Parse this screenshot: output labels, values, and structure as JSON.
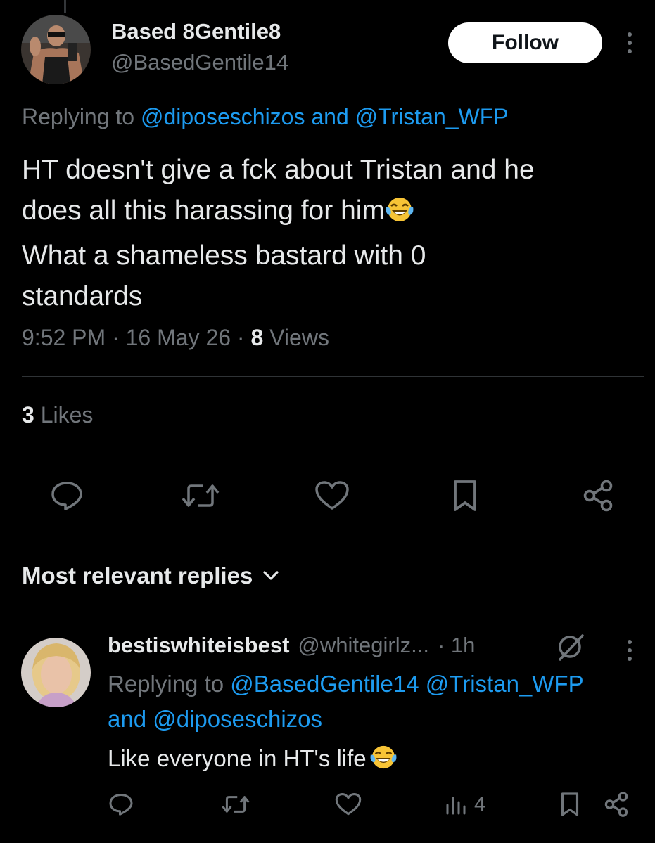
{
  "tweet": {
    "display_name": "Based 8Gentile8",
    "handle": "@BasedGentile14",
    "follow_label": "Follow",
    "replying_prefix": "Replying to",
    "replying_mention_1": "@diposeschizos",
    "replying_and": "and",
    "replying_mention_2": "@Tristan_WFP",
    "text_line_1": "HT doesn't give a fck about Tristan and he",
    "text_line_2": "does all this harassing for him",
    "text_line_3": "What a shameless bastard with 0",
    "text_line_4": "standards",
    "time": "9:52 PM",
    "dot": "·",
    "date": "16 May 26",
    "views_count": "8",
    "views_label": "Views",
    "likes_count": "3",
    "likes_label": "Likes"
  },
  "replies_header": {
    "label": "Most relevant replies"
  },
  "reply": {
    "display_name": "bestiswhiteisbest",
    "handle": "@whitegirlz...",
    "time": "· 1h",
    "replying_prefix": "Replying to",
    "mention_1": "@BasedGentile14",
    "mention_2": "@Tristan_WFP",
    "and": "and",
    "mention_3": "@diposeschizos",
    "text": "Like everyone in HT's life",
    "views_count": "4"
  },
  "icons": {
    "reply": "reply-bubble-icon",
    "retweet": "retweet-icon",
    "like": "heart-icon",
    "bookmark": "bookmark-icon",
    "share": "share-icon",
    "views": "views-bar-icon",
    "more": "more-vertical-icon",
    "grok": "grok-icon",
    "emoji": "laughing-tears-emoji"
  },
  "colors": {
    "background": "#000000",
    "text_primary": "#e7e9ea",
    "text_secondary": "#71767b",
    "link": "#1d9bf0",
    "divider": "#2f3336"
  }
}
